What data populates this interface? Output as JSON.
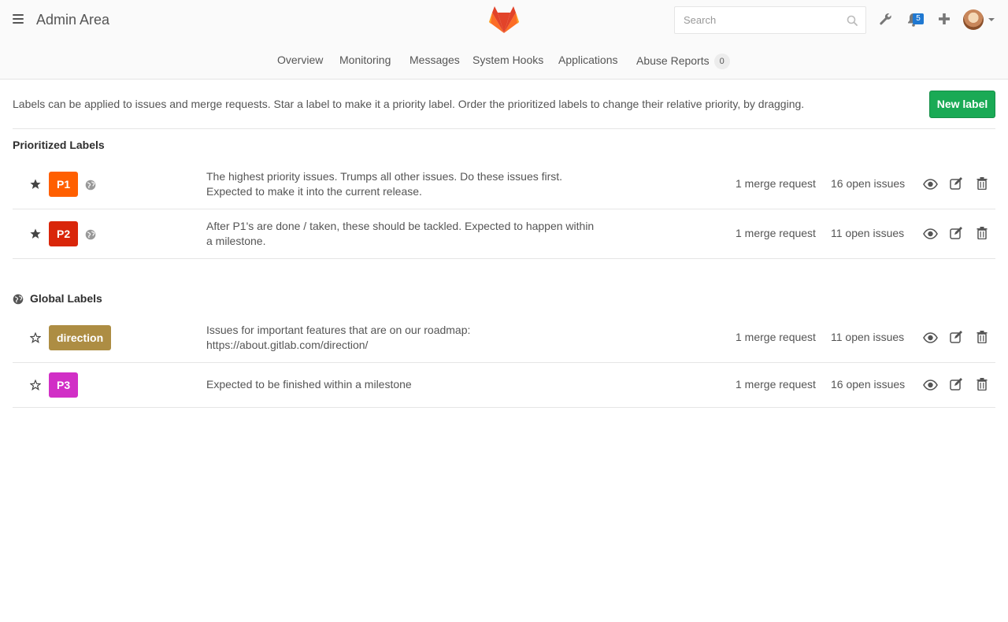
{
  "header": {
    "title": "Admin Area",
    "search_placeholder": "Search",
    "todos_count": "5",
    "icons": [
      "hamburger-icon",
      "gitlab-logo",
      "search-icon",
      "wrench-icon",
      "todos-bell-icon",
      "plus-icon",
      "avatar",
      "caret-down-icon"
    ]
  },
  "subnav": {
    "items": [
      "Overview",
      "Monitoring",
      "Messages",
      "System Hooks",
      "Applications",
      "Abuse Reports"
    ],
    "abuse_count": "0"
  },
  "intro": {
    "text": "Labels can be applied to issues and merge requests. Star a label to make it a priority label. Order the prioritized labels to change their relative priority, by dragging.",
    "new_label_button": "New label"
  },
  "prioritized": {
    "title": "Prioritized Labels",
    "labels": [
      {
        "name": "P1",
        "color": "#ff5f00",
        "starred": true,
        "global": true,
        "desc_line1": "The highest priority issues. Trumps all other issues. Do these issues first.",
        "desc_line2": "Expected to make it into the current release.",
        "merge_requests": "1 merge request",
        "open_issues": "16 open issues"
      },
      {
        "name": "P2",
        "color": "#d9260a",
        "starred": true,
        "global": true,
        "desc_line1": "After P1's are done / taken, these should be tackled. Expected to happen within",
        "desc_line2": "a milestone.",
        "merge_requests": "1 merge request",
        "open_issues": "11 open issues"
      }
    ]
  },
  "global": {
    "title": "Global Labels",
    "labels": [
      {
        "name": "direction",
        "color": "#ad8d43",
        "starred": false,
        "desc_line1": "Issues for important features that are on our roadmap:",
        "desc_line2": "https://about.gitlab.com/direction/",
        "merge_requests": "1 merge request",
        "open_issues": "11 open issues"
      },
      {
        "name": "P3",
        "color": "#d12fc6",
        "starred": false,
        "desc_line1": "Expected to be finished within a milestone",
        "desc_line2": "",
        "merge_requests": "1 merge request",
        "open_issues": "16 open issues"
      }
    ]
  },
  "colors": {
    "success_button": "#1aaa55",
    "todo_badge": "#1f78d1",
    "text_muted": "#555555"
  }
}
